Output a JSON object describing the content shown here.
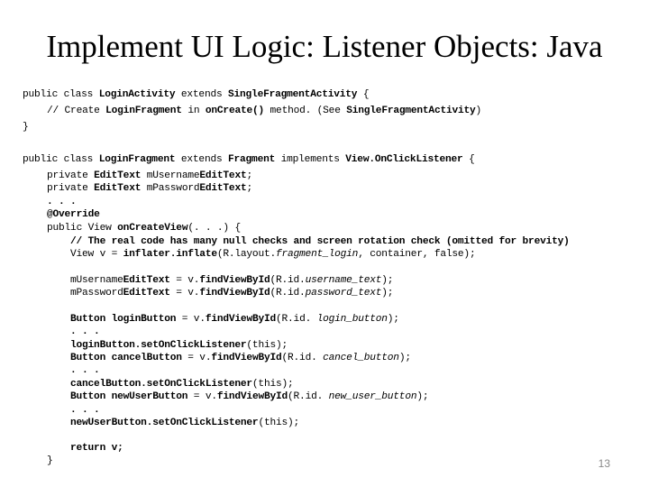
{
  "slide": {
    "title": "Implement UI Logic: Listener Objects: Java",
    "page_number": "13"
  },
  "code": {
    "lines": [
      {
        "indent": 0,
        "segments": [
          {
            "t": "public class "
          },
          {
            "t": "LoginActivity",
            "b": true
          },
          {
            "t": " extends "
          },
          {
            "t": "SingleFragmentActivity",
            "b": true
          },
          {
            "t": " {"
          }
        ]
      },
      {
        "indent": 1,
        "segments": [
          {
            "t": "// Create "
          },
          {
            "t": "LoginFragment",
            "b": true
          },
          {
            "t": " in "
          },
          {
            "t": "onCreate()",
            "b": true
          },
          {
            "t": " method. (See "
          },
          {
            "t": "SingleFragmentActivity",
            "b": true
          },
          {
            "t": ")"
          }
        ]
      },
      {
        "indent": 0,
        "segments": [
          {
            "t": "}"
          }
        ]
      },
      {
        "indent": 0,
        "segments": [
          {
            "t": ""
          }
        ]
      },
      {
        "indent": 0,
        "segments": [
          {
            "t": "public class "
          },
          {
            "t": "LoginFragment",
            "b": true
          },
          {
            "t": " extends "
          },
          {
            "t": "Fragment",
            "b": true
          },
          {
            "t": " implements "
          },
          {
            "t": "View.OnClickListener",
            "b": true
          },
          {
            "t": " {"
          }
        ]
      },
      {
        "indent": 1,
        "segments": [
          {
            "t": "private "
          },
          {
            "t": "EditText",
            "b": true
          },
          {
            "t": " mUsername"
          },
          {
            "t": "EditText",
            "b": true
          },
          {
            "t": ";"
          }
        ]
      },
      {
        "indent": 1,
        "segments": [
          {
            "t": "private "
          },
          {
            "t": "EditText",
            "b": true
          },
          {
            "t": " mPassword"
          },
          {
            "t": "EditText",
            "b": true
          },
          {
            "t": ";"
          }
        ]
      },
      {
        "indent": 1,
        "segments": [
          {
            "t": ". . .",
            "b": true
          }
        ]
      },
      {
        "indent": 1,
        "segments": [
          {
            "t": "@Override",
            "b": true
          }
        ]
      },
      {
        "indent": 1,
        "segments": [
          {
            "t": "public View "
          },
          {
            "t": "onCreateView",
            "b": true
          },
          {
            "t": "(. . .) {"
          }
        ]
      },
      {
        "indent": 2,
        "segments": [
          {
            "t": "// The real code has many null checks and screen rotation check (omitted for brevity)",
            "b": true
          }
        ]
      },
      {
        "indent": 2,
        "segments": [
          {
            "t": "View v = "
          },
          {
            "t": "inflater.inflate",
            "b": true
          },
          {
            "t": "(R.layout."
          },
          {
            "t": "fragment_login",
            "i": true
          },
          {
            "t": ", container, false);"
          }
        ]
      },
      {
        "indent": 0,
        "segments": [
          {
            "t": ""
          }
        ]
      },
      {
        "indent": 2,
        "segments": [
          {
            "t": "mUsername"
          },
          {
            "t": "EditText",
            "b": true
          },
          {
            "t": " = v."
          },
          {
            "t": "findViewById",
            "b": true
          },
          {
            "t": "(R.id."
          },
          {
            "t": "username_text",
            "i": true
          },
          {
            "t": ");"
          }
        ]
      },
      {
        "indent": 2,
        "segments": [
          {
            "t": "mPassword"
          },
          {
            "t": "EditText",
            "b": true
          },
          {
            "t": " = v."
          },
          {
            "t": "findViewById",
            "b": true
          },
          {
            "t": "(R.id."
          },
          {
            "t": "password_text",
            "i": true
          },
          {
            "t": ");"
          }
        ]
      },
      {
        "indent": 0,
        "segments": [
          {
            "t": ""
          }
        ]
      },
      {
        "indent": 2,
        "segments": [
          {
            "t": "Button login",
            "b": true
          },
          {
            "t": "Button",
            "b": true
          },
          {
            "t": " = v."
          },
          {
            "t": "findViewById",
            "b": true
          },
          {
            "t": "(R.id. "
          },
          {
            "t": "login_button",
            "i": true
          },
          {
            "t": ");"
          }
        ]
      },
      {
        "indent": 2,
        "segments": [
          {
            "t": ". . .",
            "b": true
          }
        ]
      },
      {
        "indent": 2,
        "segments": [
          {
            "t": "loginButton.setOnClickListener",
            "b": true
          },
          {
            "t": "(this);"
          }
        ]
      },
      {
        "indent": 2,
        "segments": [
          {
            "t": "Button cancelButton",
            "b": true
          },
          {
            "t": " = v."
          },
          {
            "t": "findViewById",
            "b": true
          },
          {
            "t": "(R.id. "
          },
          {
            "t": "cancel_button",
            "i": true
          },
          {
            "t": ");"
          }
        ]
      },
      {
        "indent": 2,
        "segments": [
          {
            "t": ". . .",
            "b": true
          }
        ]
      },
      {
        "indent": 2,
        "segments": [
          {
            "t": "cancelButton.setOnClickListener",
            "b": true
          },
          {
            "t": "(this);"
          }
        ]
      },
      {
        "indent": 2,
        "segments": [
          {
            "t": "Button newUserButton",
            "b": true
          },
          {
            "t": " = v."
          },
          {
            "t": "findViewById",
            "b": true
          },
          {
            "t": "(R.id. "
          },
          {
            "t": "new_user_button",
            "i": true
          },
          {
            "t": ");"
          }
        ]
      },
      {
        "indent": 2,
        "segments": [
          {
            "t": ". . .",
            "b": true
          }
        ]
      },
      {
        "indent": 2,
        "segments": [
          {
            "t": "newUserButton.setOnClickListener",
            "b": true
          },
          {
            "t": "(this);"
          }
        ]
      },
      {
        "indent": 0,
        "segments": [
          {
            "t": ""
          }
        ]
      },
      {
        "indent": 2,
        "segments": [
          {
            "t": "return v;",
            "b": true
          }
        ]
      },
      {
        "indent": 1,
        "segments": [
          {
            "t": "}"
          }
        ]
      }
    ]
  }
}
